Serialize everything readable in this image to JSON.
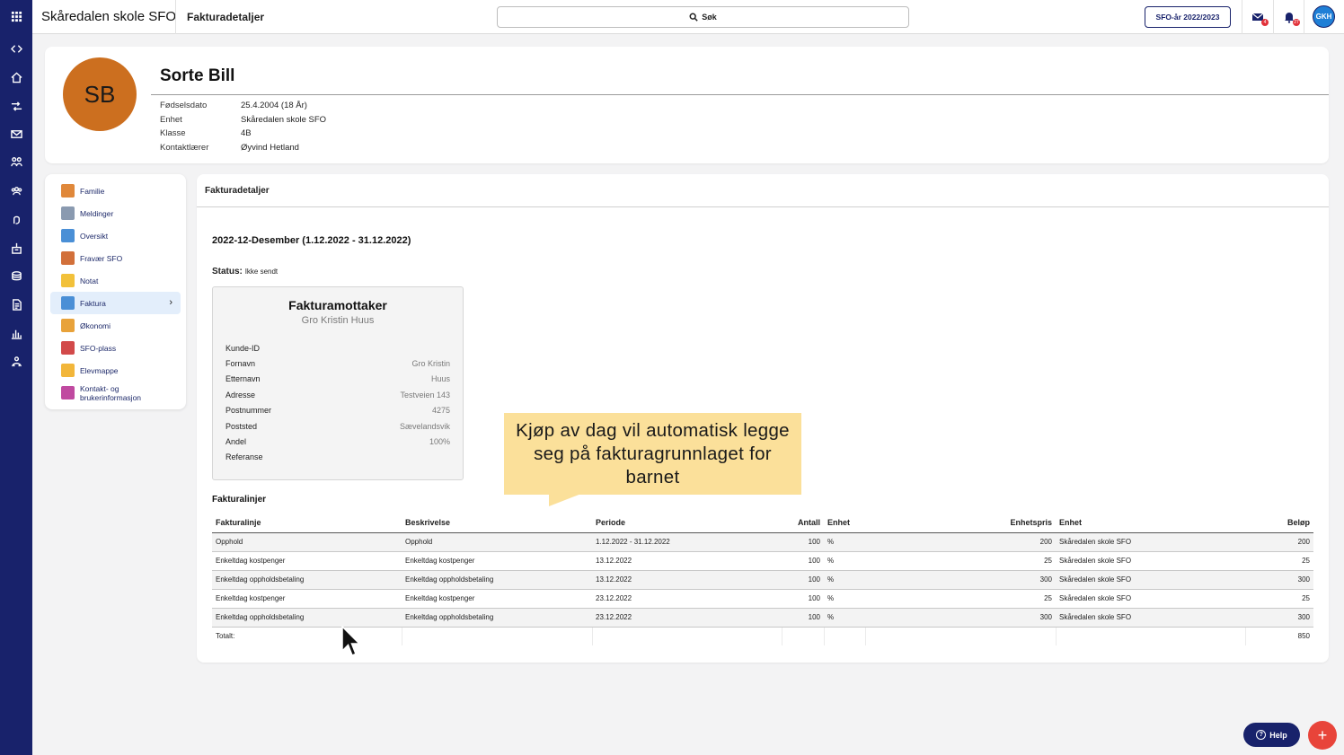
{
  "app": {
    "title": "Skåredalen skole SFO",
    "page_title": "Fakturadetaljer"
  },
  "topbar": {
    "search_label": "Søk",
    "year_button": "SFO-år 2022/2023",
    "mail_badge": "4",
    "notification_badge": "27",
    "user_initials": "GKH"
  },
  "rail": {
    "icons": [
      "expand-collapse-icon",
      "home-icon",
      "transfer-icon",
      "mail-icon",
      "people-icon",
      "group-icon",
      "hand-icon",
      "building-icon",
      "money-icon",
      "document-icon",
      "chart-icon",
      "org-icon"
    ]
  },
  "student": {
    "initials": "SB",
    "name": "Sorte Bill",
    "fields": [
      {
        "label": "Fødselsdato",
        "value": "25.4.2004 (18 År)"
      },
      {
        "label": "Enhet",
        "value": "Skåredalen skole SFO"
      },
      {
        "label": "Klasse",
        "value": "4B"
      },
      {
        "label": "Kontaktlærer",
        "value": "Øyvind Hetland"
      }
    ]
  },
  "menu": {
    "items": [
      {
        "label": "Familie",
        "color": "#e0883a"
      },
      {
        "label": "Meldinger",
        "color": "#8a9ab0"
      },
      {
        "label": "Oversikt",
        "color": "#4a8fd6"
      },
      {
        "label": "Fravær SFO",
        "color": "#d2703a"
      },
      {
        "label": "Notat",
        "color": "#f2c13a"
      },
      {
        "label": "Faktura",
        "color": "#4a8fd6"
      },
      {
        "label": "Økonomi",
        "color": "#e8a23a"
      },
      {
        "label": "SFO-plass",
        "color": "#d24a4a"
      },
      {
        "label": "Elevmappe",
        "color": "#f2b63a"
      },
      {
        "label": "Kontakt- og brukerinformasjon",
        "color": "#c04aa0"
      }
    ],
    "active_index": 5
  },
  "panel": {
    "title": "Fakturadetaljer",
    "period": "2022-12-Desember (1.12.2022 - 31.12.2022)",
    "status_label": "Status:",
    "status_value": "Ikke sendt"
  },
  "recipient": {
    "title": "Fakturamottaker",
    "name": "Gro Kristin Huus",
    "rows": [
      {
        "label": "Kunde-ID",
        "value": ""
      },
      {
        "label": "Fornavn",
        "value": "Gro Kristin"
      },
      {
        "label": "Etternavn",
        "value": "Huus"
      },
      {
        "label": "Adresse",
        "value": "Testveien 143"
      },
      {
        "label": "Postnummer",
        "value": "4275"
      },
      {
        "label": "Poststed",
        "value": "Sævelandsvik"
      },
      {
        "label": "Andel",
        "value": "100%"
      },
      {
        "label": "Referanse",
        "value": ""
      }
    ]
  },
  "callout": {
    "text": "Kjøp av dag vil automatisk legge seg på fakturagrunnlaget for barnet",
    "color": "#fbe09a"
  },
  "invoice_lines": {
    "title": "Fakturalinjer",
    "headers": [
      "Fakturalinje",
      "Beskrivelse",
      "Periode",
      "Antall",
      "Enhet",
      "Enhetspris",
      "Enhet",
      "Beløp"
    ],
    "rows": [
      [
        "Opphold",
        "Opphold",
        "1.12.2022 - 31.12.2022",
        "100",
        "%",
        "200",
        "Skåredalen skole SFO",
        "200"
      ],
      [
        "Enkeltdag kostpenger",
        "Enkeltdag kostpenger",
        "13.12.2022",
        "100",
        "%",
        "25",
        "Skåredalen skole SFO",
        "25"
      ],
      [
        "Enkeltdag oppholdsbetaling",
        "Enkeltdag oppholdsbetaling",
        "13.12.2022",
        "100",
        "%",
        "300",
        "Skåredalen skole SFO",
        "300"
      ],
      [
        "Enkeltdag kostpenger",
        "Enkeltdag kostpenger",
        "23.12.2022",
        "100",
        "%",
        "25",
        "Skåredalen skole SFO",
        "25"
      ],
      [
        "Enkeltdag oppholdsbetaling",
        "Enkeltdag oppholdsbetaling",
        "23.12.2022",
        "100",
        "%",
        "300",
        "Skåredalen skole SFO",
        "300"
      ]
    ],
    "total_label": "Totalt:",
    "total_value": "850"
  },
  "footer": {
    "help_label": "Help",
    "fab_label": "+"
  },
  "colors": {
    "brand": "#18226b",
    "avatar": "#cc6f1f",
    "accent_red": "#e8443a"
  }
}
